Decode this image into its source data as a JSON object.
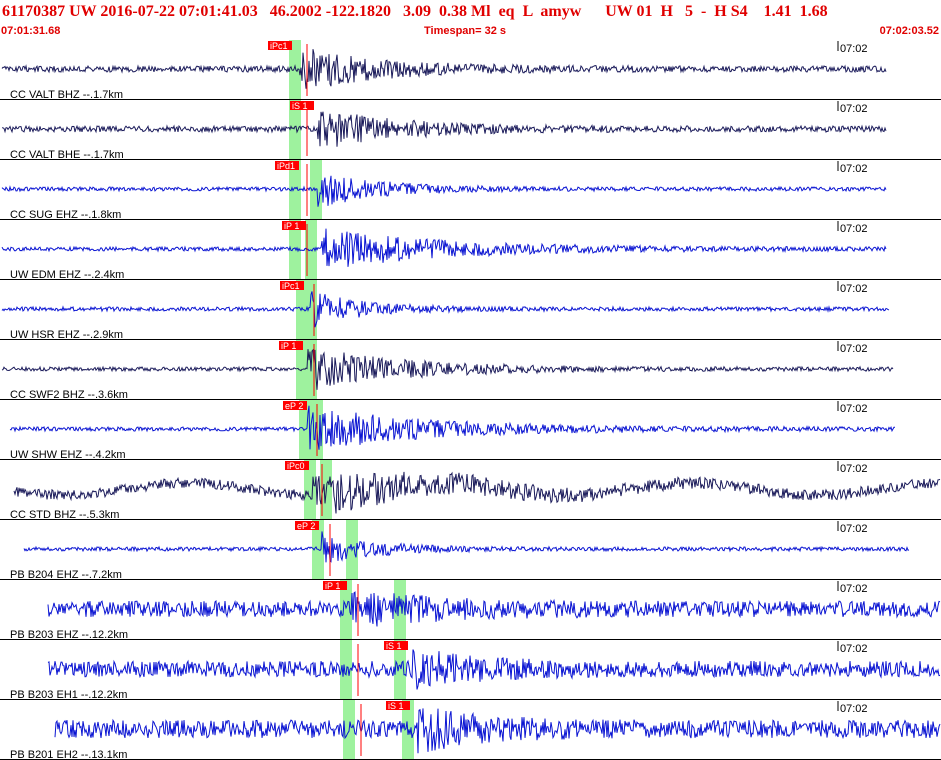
{
  "header": {
    "event_id": "61170387",
    "network": "UW",
    "origin_time": "2016-07-22 07:01:41.03",
    "latitude": "46.2002",
    "longitude": "-122.1820",
    "depth": "3.09",
    "magnitude": "0.38 Ml",
    "event_type": "eq",
    "flag": "L",
    "author": "amyw",
    "source": "UW 01",
    "quality": "H",
    "count": "5",
    "dash": "-",
    "solution": "H S4",
    "rms": "1.41",
    "erh": "1.68",
    "line1": "61170387 UW 2016-07-22 07:01:41.03   46.2002 -122.1820   3.09  0.38 Ml  eq  L  amyw      UW 01  H   5  -  H S4    1.41  1.68"
  },
  "timebar": {
    "start": "07:01:31.68",
    "timespan": "Timespan=  32 s",
    "end": "07:02:03.52"
  },
  "colors": {
    "header_text": "#e00000",
    "trace_dark": "#1a1a5a",
    "trace_blue": "#0a14d2",
    "pick_box": "#ff0000",
    "window": "#9ef29e"
  },
  "traces": [
    {
      "label": "CC VALT BHZ --.1.7km",
      "tick": "07:02",
      "pick": "iPc1",
      "color": "dark"
    },
    {
      "label": "CC VALT BHE --.1.7km",
      "tick": "07:02",
      "pick": "iS 1",
      "color": "dark"
    },
    {
      "label": "CC SUG EHZ --.1.8km",
      "tick": "07:02",
      "pick": "iPd1",
      "color": "blue"
    },
    {
      "label": "UW EDM EHZ --.2.4km",
      "tick": "07:02",
      "pick": "iP 1",
      "color": "blue"
    },
    {
      "label": "UW HSR EHZ --.2.9km",
      "tick": "07:02",
      "pick": "iPc1",
      "color": "blue"
    },
    {
      "label": "CC SWF2 BHZ --.3.6km",
      "tick": "07:02",
      "pick": "iP 1",
      "color": "dark"
    },
    {
      "label": "UW SHW EHZ --.4.2km",
      "tick": "07:02",
      "pick": "eP 2",
      "color": "blue"
    },
    {
      "label": "CC STD BHZ --.5.3km",
      "tick": "07:02",
      "pick": "iPc0",
      "color": "dark"
    },
    {
      "label": "PB B204 EHZ --.7.2km",
      "tick": "07:02",
      "pick": "eP 2",
      "color": "blue"
    },
    {
      "label": "PB B203 EHZ --.12.2km",
      "tick": "07:02",
      "pick": "iP 1",
      "color": "blue"
    },
    {
      "label": "PB B203 EH1 --.12.2km",
      "tick": "07:02",
      "pick": "iS 1",
      "color": "blue"
    },
    {
      "label": "PB B201 EH2 --.13.1km",
      "tick": "07:02",
      "pick": "iS 1",
      "color": "blue"
    }
  ]
}
